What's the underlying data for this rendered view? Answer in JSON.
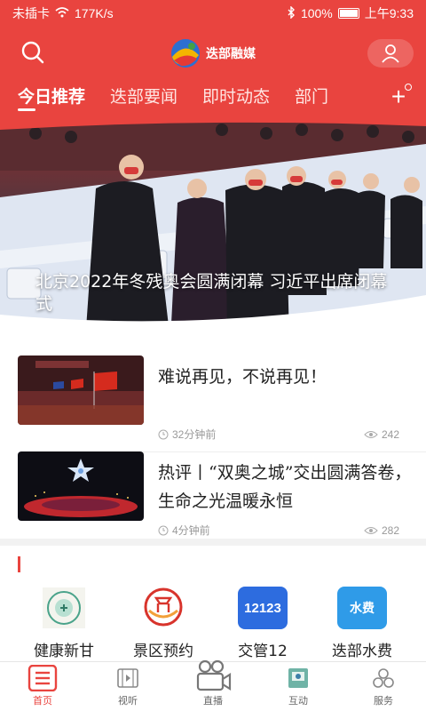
{
  "status": {
    "sim": "未插卡",
    "speed": "177K/s",
    "battery": "100%",
    "time": "上午9:33"
  },
  "header": {
    "logo_text": "迭部融媒"
  },
  "tabs": [
    {
      "label": "今日推荐",
      "active": true
    },
    {
      "label": "迭部要闻",
      "active": false
    },
    {
      "label": "即时动态",
      "active": false
    },
    {
      "label": "部门",
      "active": false
    }
  ],
  "hero": {
    "caption": "北京2022年冬残奥会圆满闭幕 习近平出席闭幕式"
  },
  "news": [
    {
      "title": "难说再见，不说再见！",
      "time": "32分钟前",
      "views": "242"
    },
    {
      "title": "热评丨“双奥之城”交出圆满答卷，生命之光温暖永恒",
      "time": "4分钟前",
      "views": "282"
    }
  ],
  "services": [
    {
      "label": "健康新甘",
      "icon": "health-icon"
    },
    {
      "label": "景区预约",
      "icon": "scenic-icon"
    },
    {
      "label": "交管12",
      "icon": "traffic-icon",
      "badge": "12123"
    },
    {
      "label": "迭部水费",
      "icon": "water-icon",
      "badge": "水费"
    }
  ],
  "nav": [
    {
      "label": "首页",
      "icon": "home-icon",
      "active": true
    },
    {
      "label": "视听",
      "icon": "video-icon",
      "active": false
    },
    {
      "label": "直播",
      "icon": "live-icon",
      "active": false
    },
    {
      "label": "互动",
      "icon": "interact-icon",
      "active": false
    },
    {
      "label": "服务",
      "icon": "service-icon",
      "active": false
    }
  ],
  "colors": {
    "brand": "#e9443f",
    "text": "#222222",
    "meta": "#999999"
  }
}
